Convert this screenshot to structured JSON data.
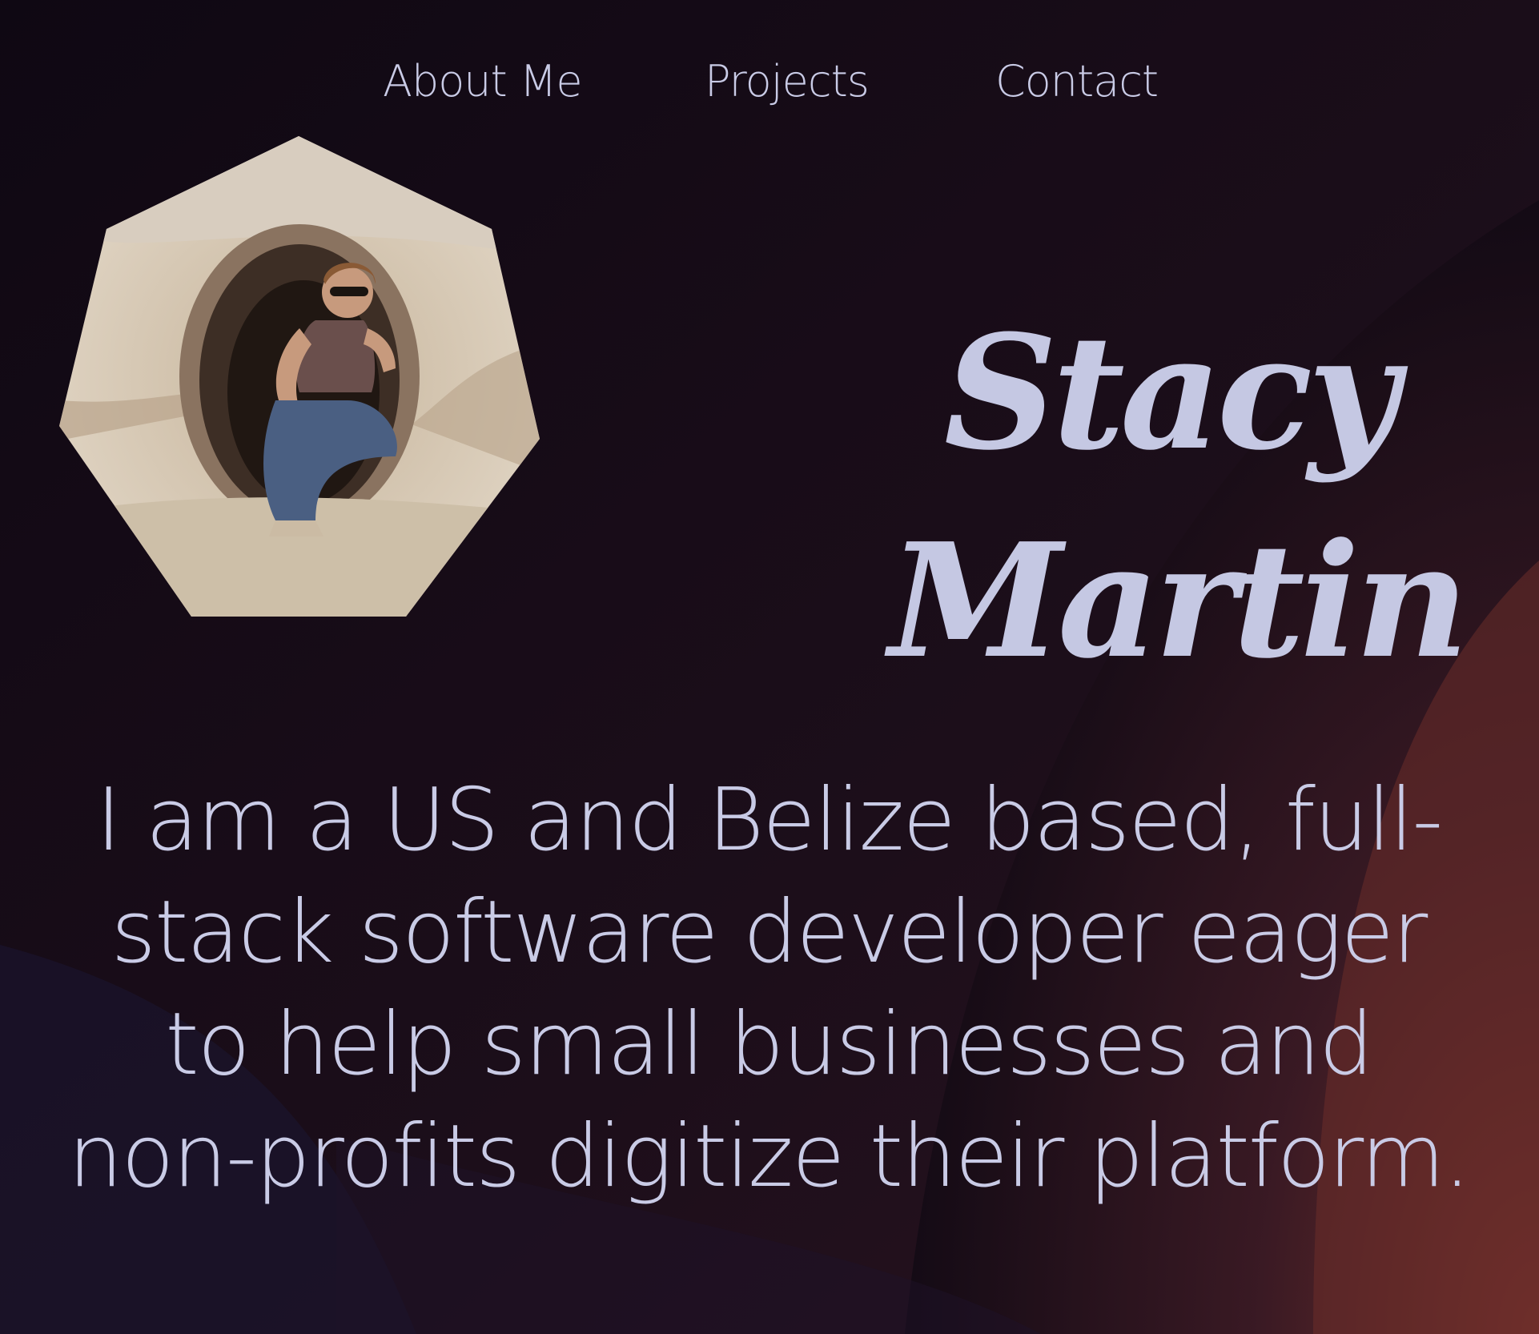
{
  "nav": {
    "items": [
      {
        "label": "About Me"
      },
      {
        "label": "Projects"
      },
      {
        "label": "Contact"
      }
    ]
  },
  "profile": {
    "photo_icon": "portrait-photo",
    "first_name": "Stacy",
    "last_name": "Martin"
  },
  "intro": {
    "lines": [
      "I am a US and Belize based, full-",
      "stack software developer eager",
      "to help small businesses and",
      "non-profits digitize their platform."
    ]
  },
  "colors": {
    "background_dark": "#120a14",
    "background_accent": "#6a2c28",
    "text": "#c9cbe6"
  }
}
